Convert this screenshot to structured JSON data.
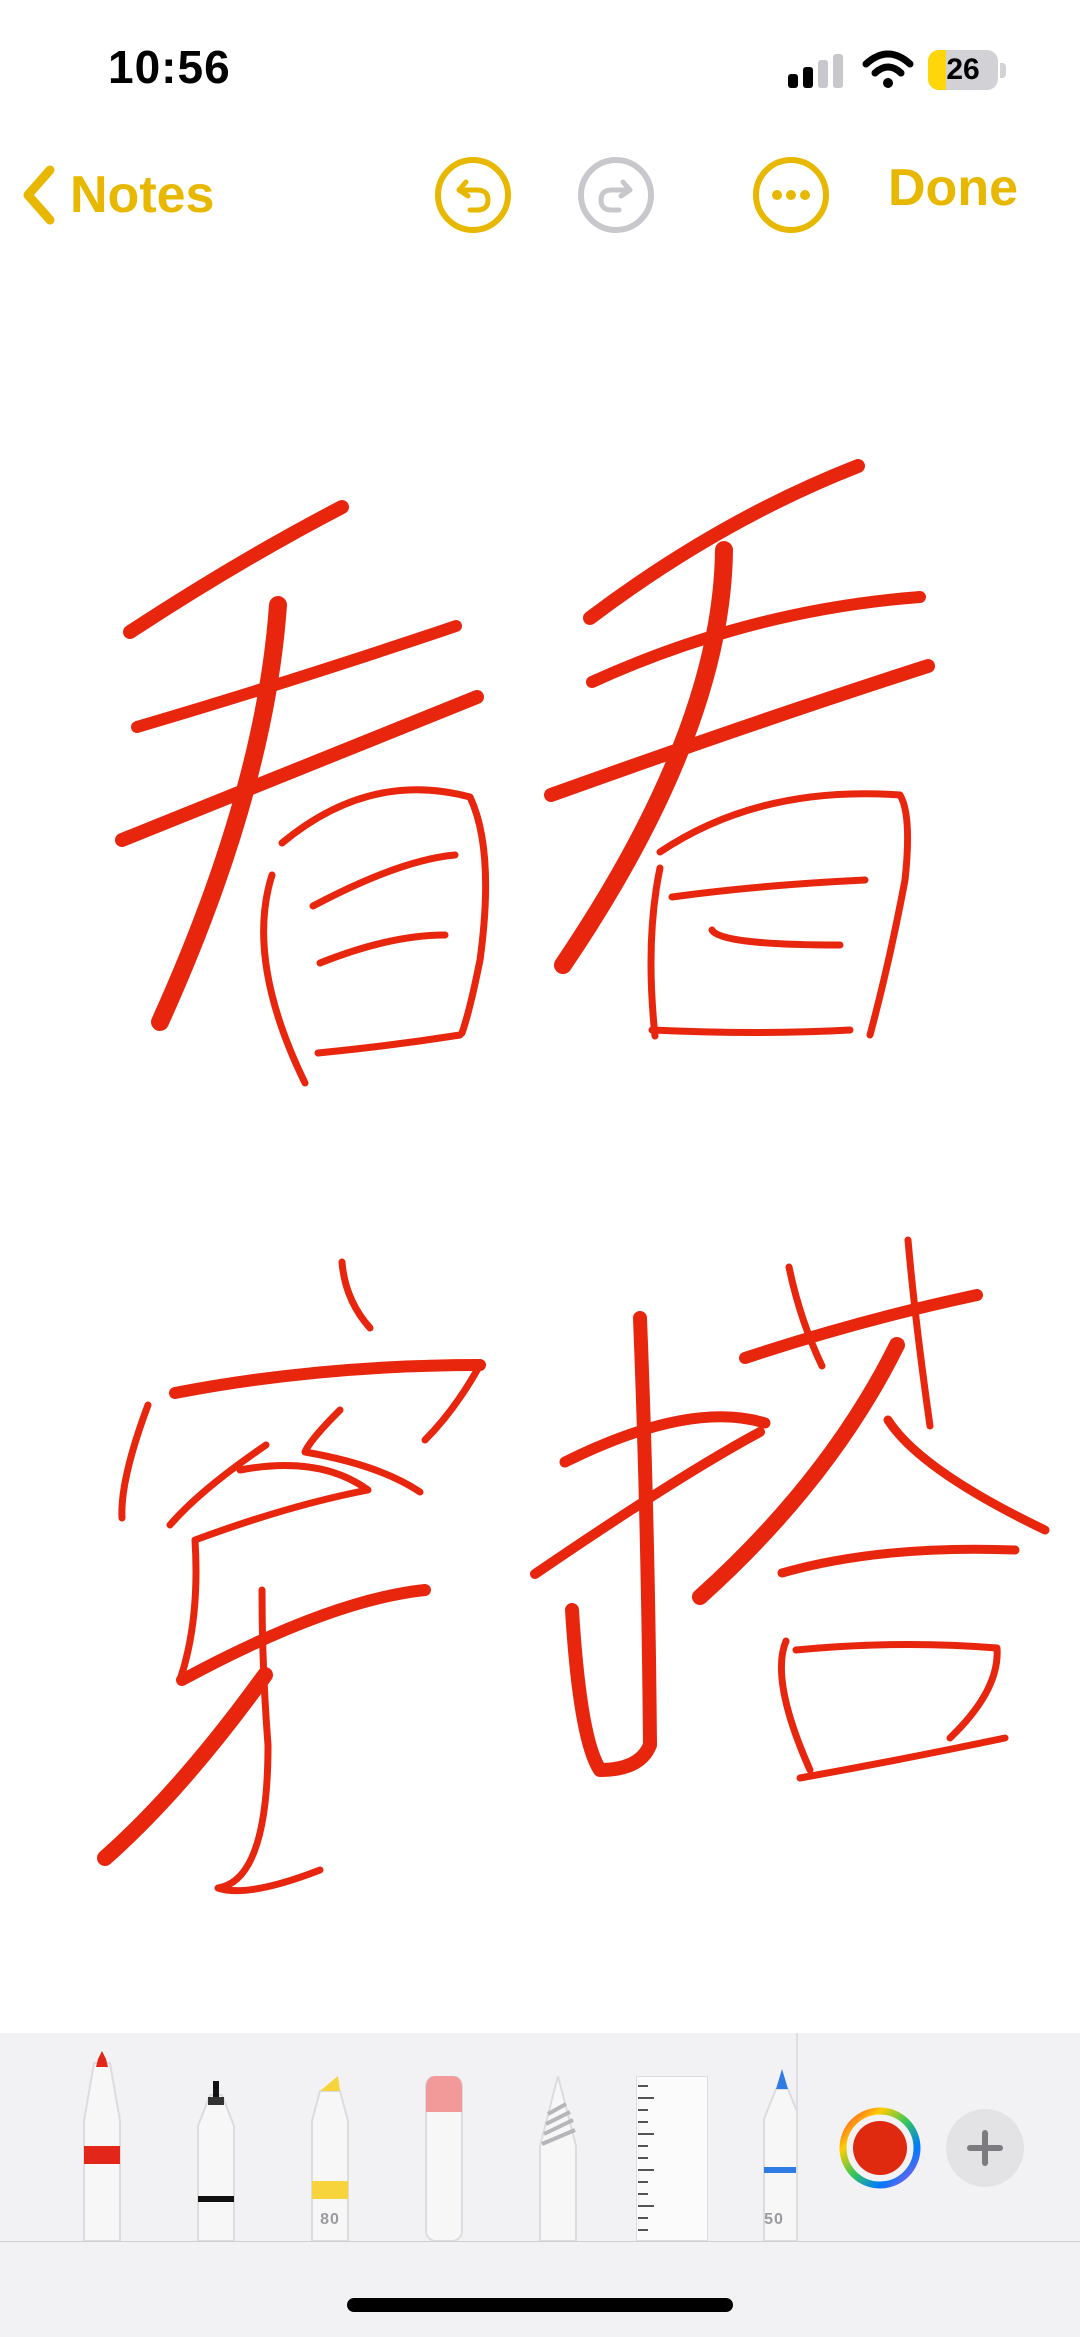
{
  "status_bar": {
    "time": "10:56",
    "battery_level": "26",
    "battery_fraction": 0.26
  },
  "nav": {
    "back_label": "Notes",
    "done_label": "Done",
    "accent_color": "#e8b800"
  },
  "drawing": {
    "characters": [
      "看",
      "看",
      "穿",
      "搭"
    ],
    "ink_color": "#e8260e"
  },
  "tool_palette": {
    "tools": [
      {
        "name": "pen",
        "color": "#e3261a"
      },
      {
        "name": "fineliner",
        "color": "#000000"
      },
      {
        "name": "highlighter",
        "color": "#f7d43c",
        "label": "80"
      },
      {
        "name": "eraser"
      },
      {
        "name": "pencil"
      },
      {
        "name": "ruler"
      },
      {
        "name": "crayon",
        "color": "#2e7be4",
        "label": "50"
      }
    ],
    "selected_color": "#e02a10"
  }
}
